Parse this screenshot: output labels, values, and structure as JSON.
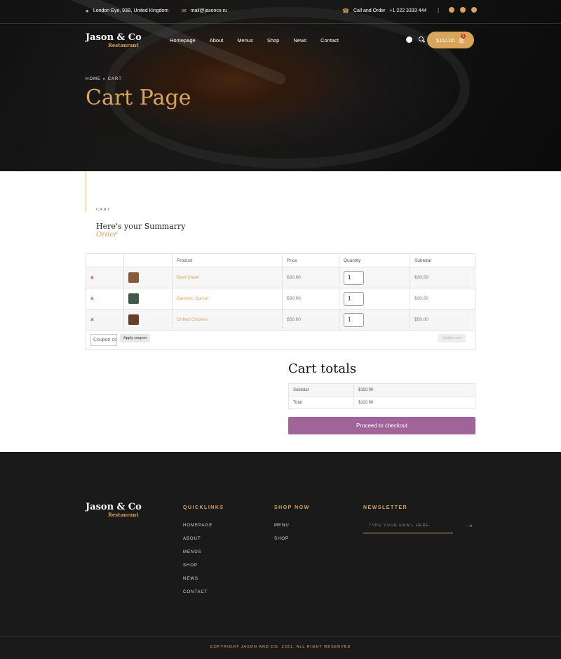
{
  "topbar": {
    "address": "London Eye, 93B, United Kingdom",
    "email": "mail@jasonco.ru",
    "call_label": "Call and Order",
    "phone": "+1 222 3333 444"
  },
  "brand": {
    "name": "Jason & Co",
    "sub": "Restaurant"
  },
  "nav": {
    "items": [
      "Homepage",
      "About",
      "Menus",
      "Shop",
      "News",
      "Contact"
    ],
    "cart_total": "$110.00",
    "cart_count": "3"
  },
  "hero": {
    "breadcrumb": "HOME » CART",
    "title": "Cart Page"
  },
  "summary": {
    "eyebrow": "CART",
    "title": "Here's your Summarry",
    "subtitle": "Order"
  },
  "cart": {
    "headers": [
      "",
      "",
      "Product",
      "Price",
      "Quantity",
      "Subtotal"
    ],
    "rows": [
      {
        "remove": "×",
        "product": "Beef Steak",
        "price": "$30.00",
        "qty": "1",
        "subtotal": "$30.00"
      },
      {
        "remove": "×",
        "product": "Bamboo Sprout",
        "price": "$30.00",
        "qty": "1",
        "subtotal": "$30.00"
      },
      {
        "remove": "×",
        "product": "Grilled Chicken",
        "price": "$50.00",
        "qty": "1",
        "subtotal": "$50.00"
      }
    ],
    "coupon_placeholder": "Coupon code",
    "apply_label": "Apply coupon",
    "update_label": "Update cart"
  },
  "totals": {
    "title": "Cart totals",
    "subtotal_label": "Subtotal",
    "subtotal_value": "$110.00",
    "total_label": "Total",
    "total_value": "$110.00",
    "checkout_label": "Proceed to checkout"
  },
  "footer": {
    "quicklinks_title": "QUICKLINKS",
    "quicklinks": [
      "HOMEPAGE",
      "ABOUT",
      "MENUS",
      "SHOP",
      "NEWS",
      "CONTACT"
    ],
    "shop_title": "SHOP NOW",
    "shop_links": [
      "MENU",
      "SHOP"
    ],
    "newsletter_title": "NEWSLETTER",
    "newsletter_placeholder": "TYPE YOUR EMAIL HERE",
    "copyright": "COPYRIGHT JASON AND CO. 2021. ALL RIGHT RESERVED"
  },
  "colors": {
    "accent": "#d9a55b",
    "checkout": "#a0639a",
    "remove": "#c0392b",
    "footer_bg": "#1a1a1a"
  },
  "icons": [
    "map-pin-icon",
    "mail-icon",
    "phone-icon",
    "facebook-icon",
    "twitter-icon",
    "youtube-icon",
    "user-icon",
    "search-icon",
    "shopping-bag-icon",
    "arrow-right-icon"
  ]
}
